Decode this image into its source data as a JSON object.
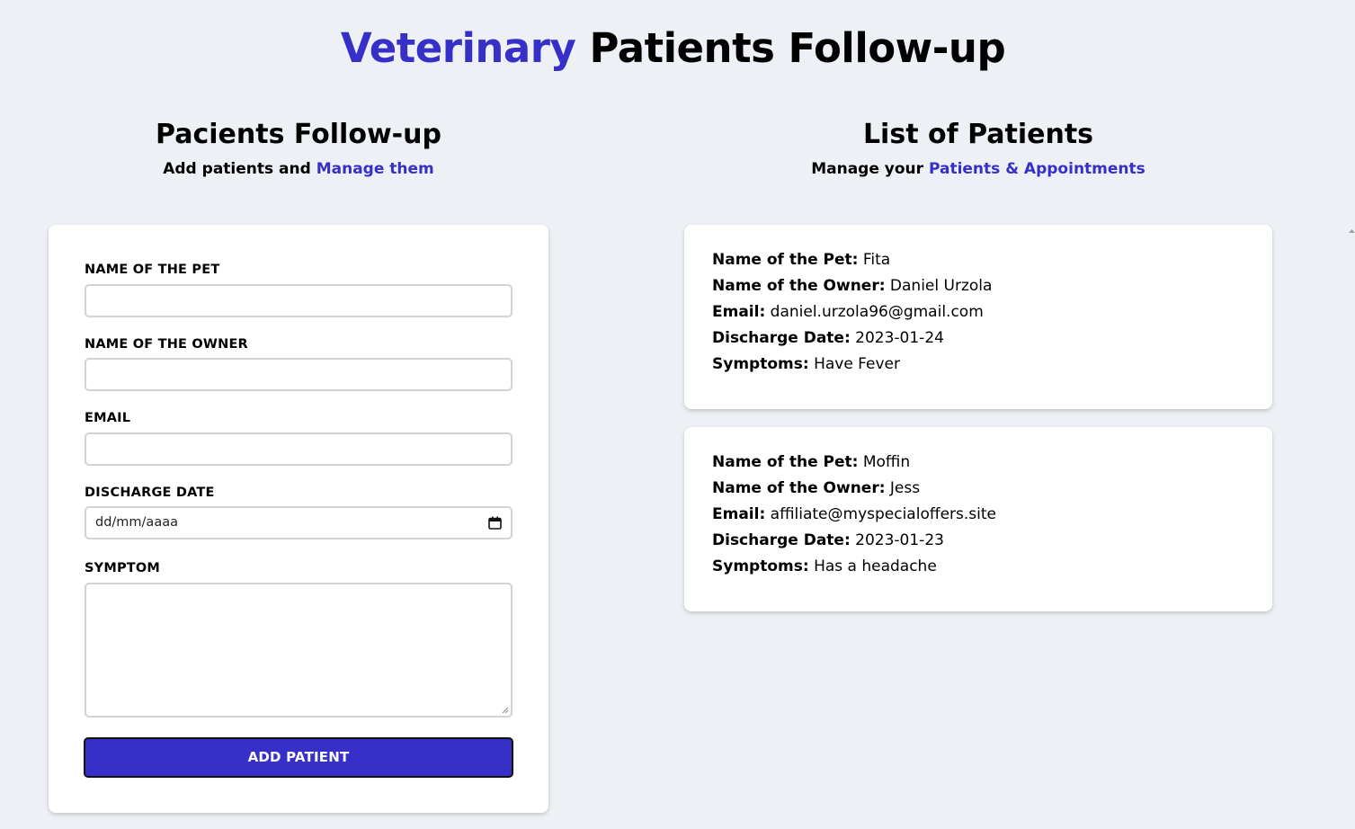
{
  "colors": {
    "accent": "#3730c8",
    "background": "#edf0f4",
    "card": "#ffffff"
  },
  "header": {
    "title_accent": "Veterinary",
    "title_rest": " Patients Follow-up"
  },
  "form_section": {
    "title": "Pacients Follow-up",
    "subtitle_prefix": "Add patients and ",
    "subtitle_accent": "Manage them",
    "fields": {
      "pet_label": "NAME OF THE PET",
      "owner_label": "NAME OF THE OWNER",
      "email_label": "EMAIL",
      "date_label": "DISCHARGE DATE",
      "date_placeholder": "dd/mm/aaaa",
      "symptom_label": "SYMPTOM"
    },
    "submit_label": "ADD PATIENT"
  },
  "list_section": {
    "title": "List of Patients",
    "subtitle_prefix": "Manage your ",
    "subtitle_accent": "Patients & Appointments",
    "labels": {
      "pet": "Name of the Pet:",
      "owner": "Name of the Owner:",
      "email": "Email:",
      "date": "Discharge Date:",
      "symptoms": "Symptoms:"
    },
    "patients": [
      {
        "pet": "Fita",
        "owner": "Daniel Urzola",
        "email": "daniel.urzola96@gmail.com",
        "date": "2023-01-24",
        "symptoms": "Have Fever"
      },
      {
        "pet": "Moffin",
        "owner": "Jess",
        "email": "affiliate@myspecialoffers.site",
        "date": "2023-01-23",
        "symptoms": "Has a headache"
      }
    ]
  }
}
